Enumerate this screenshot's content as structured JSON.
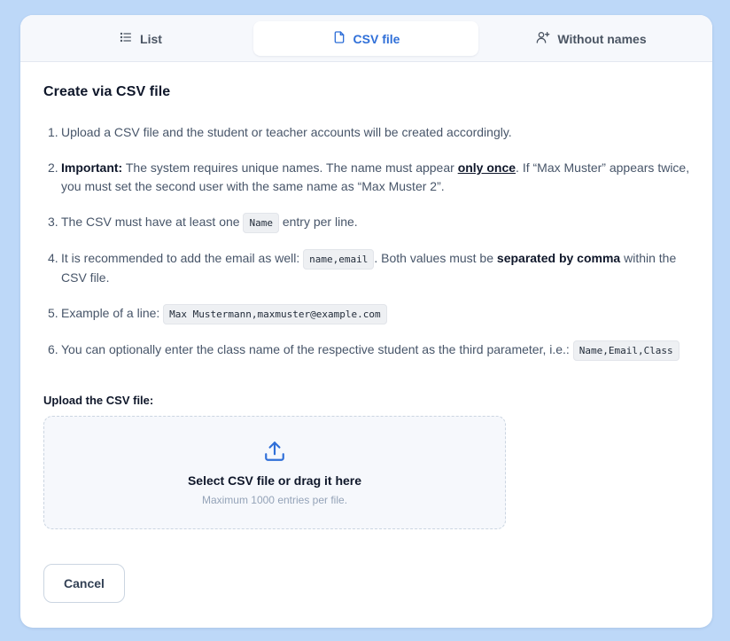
{
  "tabs": [
    {
      "label": "List",
      "icon": "list-icon"
    },
    {
      "label": "CSV file",
      "icon": "file-icon",
      "active": true
    },
    {
      "label": "Without names",
      "icon": "user-plus-icon"
    }
  ],
  "title": "Create via CSV file",
  "steps": {
    "s1": {
      "num": "1.",
      "text": "Upload a CSV file and the student or teacher accounts will be created accordingly."
    },
    "s2": {
      "num": "2.",
      "bold": "Important:",
      "text_a": " The system requires unique names. The name must appear ",
      "emph": "only once",
      "text_b": ". If “Max Muster” appears twice, you must set the second user with the same name as “Max Muster 2”."
    },
    "s3": {
      "num": "3.",
      "text_a": "The CSV must have at least one ",
      "code": "Name",
      "text_b": " entry per line."
    },
    "s4": {
      "num": "4.",
      "text_a": "It is recommended to add the email as well: ",
      "code": "name,email",
      "text_b": ". Both values must be ",
      "bold": "separated by comma",
      "text_c": " within the CSV file."
    },
    "s5": {
      "num": "5.",
      "text_a": "Example of a line: ",
      "code": "Max Mustermann,maxmuster@example.com"
    },
    "s6": {
      "num": "6.",
      "text_a": "You can optionally enter the class name of the respective student as the third parameter, i.e.: ",
      "code": "Name,Email,Class"
    }
  },
  "upload": {
    "label": "Upload the CSV file:",
    "title": "Select CSV file or drag it here",
    "subtitle": "Maximum 1000 entries per file.",
    "icon": "upload-icon"
  },
  "cancel_label": "Cancel",
  "colors": {
    "background": "#bdd8f8",
    "accent": "#2f6fd8",
    "heading": "#0f172a",
    "text": "#475569"
  }
}
